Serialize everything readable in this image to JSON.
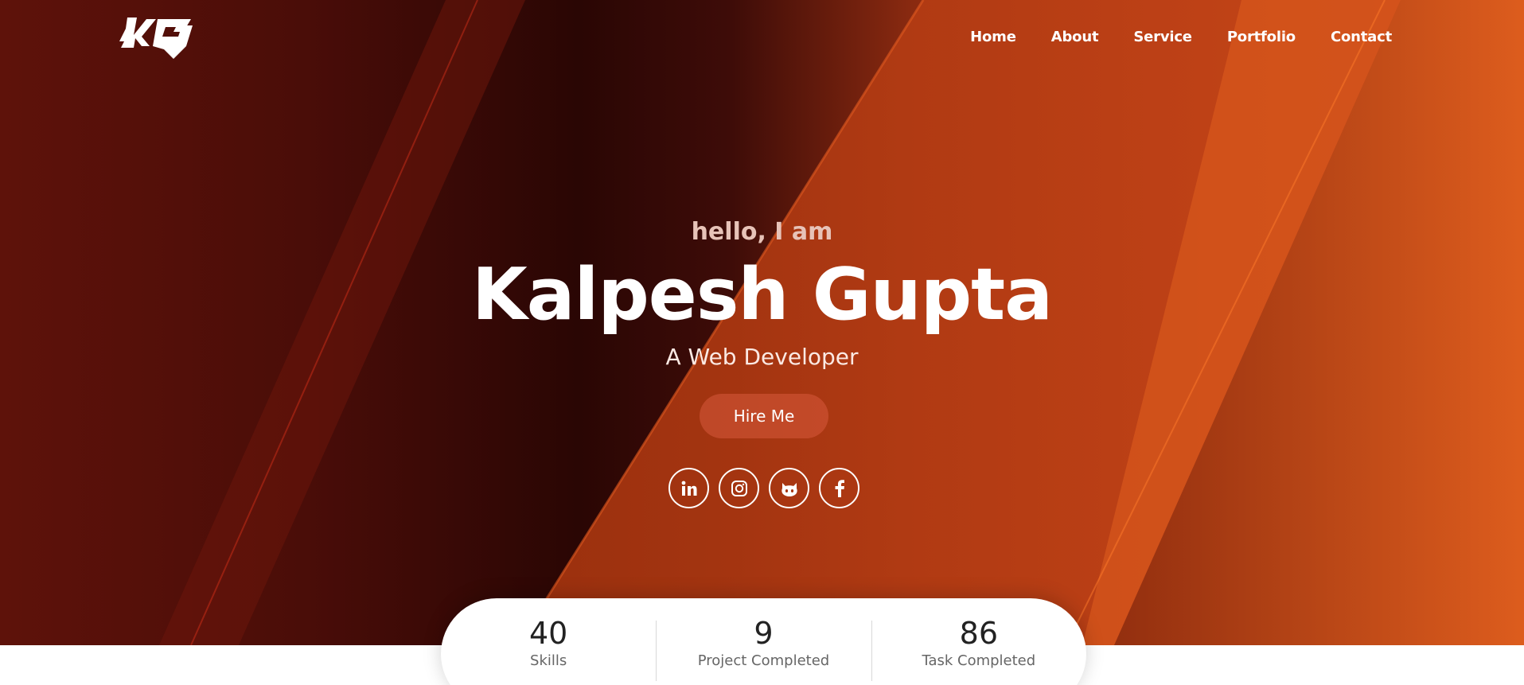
{
  "brand": {
    "logo_text": "KG"
  },
  "nav": {
    "items": [
      "Home",
      "About",
      "Service",
      "Portfolio",
      "Contact"
    ]
  },
  "hero": {
    "greeting": "hello, I am",
    "name": "Kalpesh Gupta",
    "role": "A Web Developer",
    "cta_label": "Hire Me",
    "socials": [
      {
        "icon": "linkedin-icon"
      },
      {
        "icon": "instagram-icon"
      },
      {
        "icon": "github-icon"
      },
      {
        "icon": "facebook-icon"
      }
    ]
  },
  "stats": [
    {
      "value": "40",
      "label": "Skills"
    },
    {
      "value": "9",
      "label": "Project Completed"
    },
    {
      "value": "86",
      "label": "Task Completed"
    }
  ],
  "colors": {
    "accent": "#d9531a",
    "dark": "#2a0604",
    "cta": "#c9553a"
  }
}
